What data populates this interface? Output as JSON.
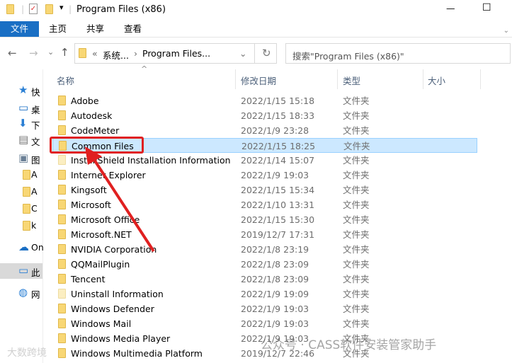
{
  "window": {
    "title": "Program Files (x86)",
    "minimize": "—",
    "maximize": "☐"
  },
  "ribbon": {
    "tabs": [
      "文件",
      "主页",
      "共享",
      "查看"
    ]
  },
  "nav": {
    "back": "←",
    "forward": "→",
    "recent": "⌄",
    "up": "↑"
  },
  "address": {
    "overflow": "«",
    "crumbs": [
      "系统...",
      "Program Files..."
    ],
    "sep": "›",
    "dropdown": "⌄",
    "refresh": "↻"
  },
  "search": {
    "placeholder": "搜索\"Program Files (x86)\""
  },
  "columns": {
    "name": "名称",
    "date": "修改日期",
    "type": "类型",
    "size": "大小",
    "sort": "^"
  },
  "sidebar": [
    {
      "label": "快",
      "icon": "star-icon"
    },
    {
      "label": "桌",
      "icon": "desktop-icon"
    },
    {
      "label": "下",
      "icon": "download-icon"
    },
    {
      "label": "文",
      "icon": "document-icon"
    },
    {
      "label": "图",
      "icon": "picture-icon"
    },
    {
      "label": "A",
      "icon": "folder-icon"
    },
    {
      "label": "A",
      "icon": "folder-icon"
    },
    {
      "label": "C",
      "icon": "folder-icon"
    },
    {
      "label": "k",
      "icon": "folder-icon"
    },
    {
      "label": "On",
      "icon": "cloud-icon"
    },
    {
      "label": "此",
      "icon": "computer-icon"
    },
    {
      "label": "网",
      "icon": "network-icon"
    }
  ],
  "files": [
    {
      "name": "Adobe",
      "date": "2022/1/15 15:18",
      "type": "文件夹"
    },
    {
      "name": "Autodesk",
      "date": "2022/1/15 18:33",
      "type": "文件夹"
    },
    {
      "name": "CodeMeter",
      "date": "2022/1/9 23:28",
      "type": "文件夹"
    },
    {
      "name": "Common Files",
      "date": "2022/1/15 18:25",
      "type": "文件夹",
      "selected": true
    },
    {
      "name": "InstallShield Installation Information",
      "date": "2022/1/14 15:07",
      "type": "文件夹",
      "hidden": true
    },
    {
      "name": "Internet Explorer",
      "date": "2022/1/9 19:03",
      "type": "文件夹"
    },
    {
      "name": "Kingsoft",
      "date": "2022/1/15 15:34",
      "type": "文件夹"
    },
    {
      "name": "Microsoft",
      "date": "2022/1/10 13:31",
      "type": "文件夹"
    },
    {
      "name": "Microsoft Office",
      "date": "2022/1/15 15:30",
      "type": "文件夹"
    },
    {
      "name": "Microsoft.NET",
      "date": "2019/12/7 17:31",
      "type": "文件夹"
    },
    {
      "name": "NVIDIA Corporation",
      "date": "2022/1/8 23:19",
      "type": "文件夹"
    },
    {
      "name": "QQMailPlugin",
      "date": "2022/1/8 23:09",
      "type": "文件夹"
    },
    {
      "name": "Tencent",
      "date": "2022/1/8 23:09",
      "type": "文件夹"
    },
    {
      "name": "Uninstall Information",
      "date": "2022/1/9 19:09",
      "type": "文件夹",
      "hidden": true
    },
    {
      "name": "Windows Defender",
      "date": "2022/1/9 19:03",
      "type": "文件夹"
    },
    {
      "name": "Windows Mail",
      "date": "2022/1/9 19:03",
      "type": "文件夹"
    },
    {
      "name": "Windows Media Player",
      "date": "2022/1/9 19:03",
      "type": "文件夹"
    },
    {
      "name": "Windows Multimedia Platform",
      "date": "2019/12/7 22:46",
      "type": "文件夹"
    }
  ],
  "watermarks": [
    "公众号 · CASS软件安装管家助手",
    "大数跨境"
  ],
  "colors": {
    "accent": "#1a6fc4",
    "selection": "#cce8ff",
    "highlight": "#e02020"
  }
}
